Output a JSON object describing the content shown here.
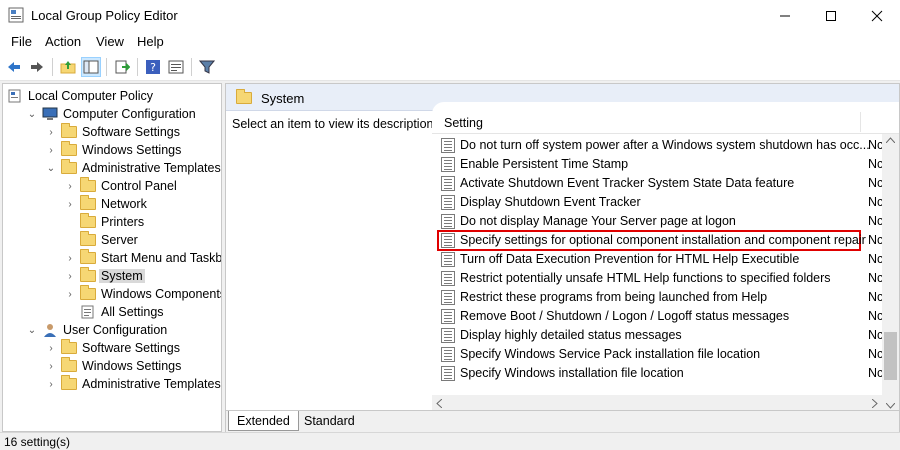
{
  "window": {
    "title": "Local Group Policy Editor"
  },
  "menu": [
    "File",
    "Action",
    "View",
    "Help"
  ],
  "tree": [
    {
      "label": "Local Computer Policy",
      "depth": 0,
      "expander": "",
      "icon": "policy-icon"
    },
    {
      "label": "Computer Configuration",
      "depth": 1,
      "expander": "open",
      "icon": "computer-icon"
    },
    {
      "label": "Software Settings",
      "depth": 2,
      "expander": "closed",
      "icon": "folder-icon"
    },
    {
      "label": "Windows Settings",
      "depth": 2,
      "expander": "closed",
      "icon": "folder-icon"
    },
    {
      "label": "Administrative Templates",
      "depth": 2,
      "expander": "open",
      "icon": "folder-icon"
    },
    {
      "label": "Control Panel",
      "depth": 3,
      "expander": "closed",
      "icon": "folder-icon"
    },
    {
      "label": "Network",
      "depth": 3,
      "expander": "closed",
      "icon": "folder-icon"
    },
    {
      "label": "Printers",
      "depth": 3,
      "expander": "",
      "icon": "folder-icon"
    },
    {
      "label": "Server",
      "depth": 3,
      "expander": "",
      "icon": "folder-icon"
    },
    {
      "label": "Start Menu and Taskbar",
      "depth": 3,
      "expander": "closed",
      "icon": "folder-icon"
    },
    {
      "label": "System",
      "depth": 3,
      "expander": "closed",
      "icon": "folder-icon",
      "selected": true
    },
    {
      "label": "Windows Components",
      "depth": 3,
      "expander": "closed",
      "icon": "folder-icon"
    },
    {
      "label": "All Settings",
      "depth": 3,
      "expander": "",
      "icon": "settings-icon"
    },
    {
      "label": "User Configuration",
      "depth": 1,
      "expander": "open",
      "icon": "user-icon"
    },
    {
      "label": "Software Settings",
      "depth": 2,
      "expander": "closed",
      "icon": "folder-icon"
    },
    {
      "label": "Windows Settings",
      "depth": 2,
      "expander": "closed",
      "icon": "folder-icon"
    },
    {
      "label": "Administrative Templates",
      "depth": 2,
      "expander": "closed",
      "icon": "folder-icon"
    }
  ],
  "panel": {
    "title": "System",
    "description": "Select an item to view its description.",
    "column_setting": "Setting"
  },
  "settings": [
    {
      "name": "Do not turn off system power after a Windows system shutdown has occ...",
      "state": "Nc"
    },
    {
      "name": "Enable Persistent Time Stamp",
      "state": "Nc"
    },
    {
      "name": "Activate Shutdown Event Tracker System State Data feature",
      "state": "Nc"
    },
    {
      "name": "Display Shutdown Event Tracker",
      "state": "Nc"
    },
    {
      "name": "Do not display Manage Your Server page at logon",
      "state": "Nc"
    },
    {
      "name": "Specify settings for optional component installation and component repair",
      "state": "Nc",
      "highlight": true
    },
    {
      "name": "Turn off Data Execution Prevention for HTML Help Executible",
      "state": "Nc"
    },
    {
      "name": "Restrict potentially unsafe HTML Help functions to specified folders",
      "state": "Nc"
    },
    {
      "name": "Restrict these programs from being launched from Help",
      "state": "Nc"
    },
    {
      "name": "Remove Boot / Shutdown / Logon / Logoff status messages",
      "state": "Nc"
    },
    {
      "name": "Display highly detailed status messages",
      "state": "Nc"
    },
    {
      "name": "Specify Windows Service Pack installation file location",
      "state": "Nc"
    },
    {
      "name": "Specify Windows installation file location",
      "state": "Nc"
    }
  ],
  "tabs": [
    "Extended",
    "Standard"
  ],
  "status": "16 setting(s)",
  "colors": {
    "highlight_border": "#e00000",
    "header_bg": "#e8eef8"
  }
}
